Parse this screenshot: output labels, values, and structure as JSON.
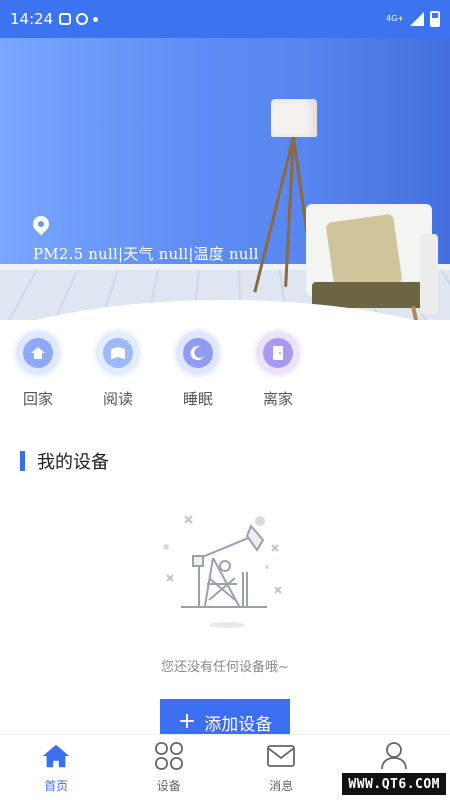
{
  "status_bar": {
    "time": "14:24",
    "network": "4G+"
  },
  "hero": {
    "env_info": "PM2.5 null|天气 null|温度 null",
    "location_icon": "location-pin-icon"
  },
  "scenes": [
    {
      "label": "回家",
      "icon": "home-icon"
    },
    {
      "label": "阅读",
      "icon": "book-icon"
    },
    {
      "label": "睡眠",
      "icon": "moon-icon"
    },
    {
      "label": "离家",
      "icon": "leave-icon"
    }
  ],
  "section": {
    "title": "我的设备"
  },
  "empty_state": {
    "text": "您还没有任何设备哦~",
    "add_button_label": "添加设备",
    "add_button_icon": "plus-icon"
  },
  "bottom_nav": {
    "items": [
      {
        "label": "首页",
        "icon": "home-icon",
        "active": true
      },
      {
        "label": "设备",
        "icon": "grid-icon",
        "active": false
      },
      {
        "label": "消息",
        "icon": "mail-icon",
        "active": false
      },
      {
        "label": "我的",
        "icon": "user-icon",
        "active": false
      }
    ]
  },
  "watermark": "WWW.QT6.COM",
  "colors": {
    "primary": "#3b6ff0",
    "status_bar": "#3b73f0"
  }
}
